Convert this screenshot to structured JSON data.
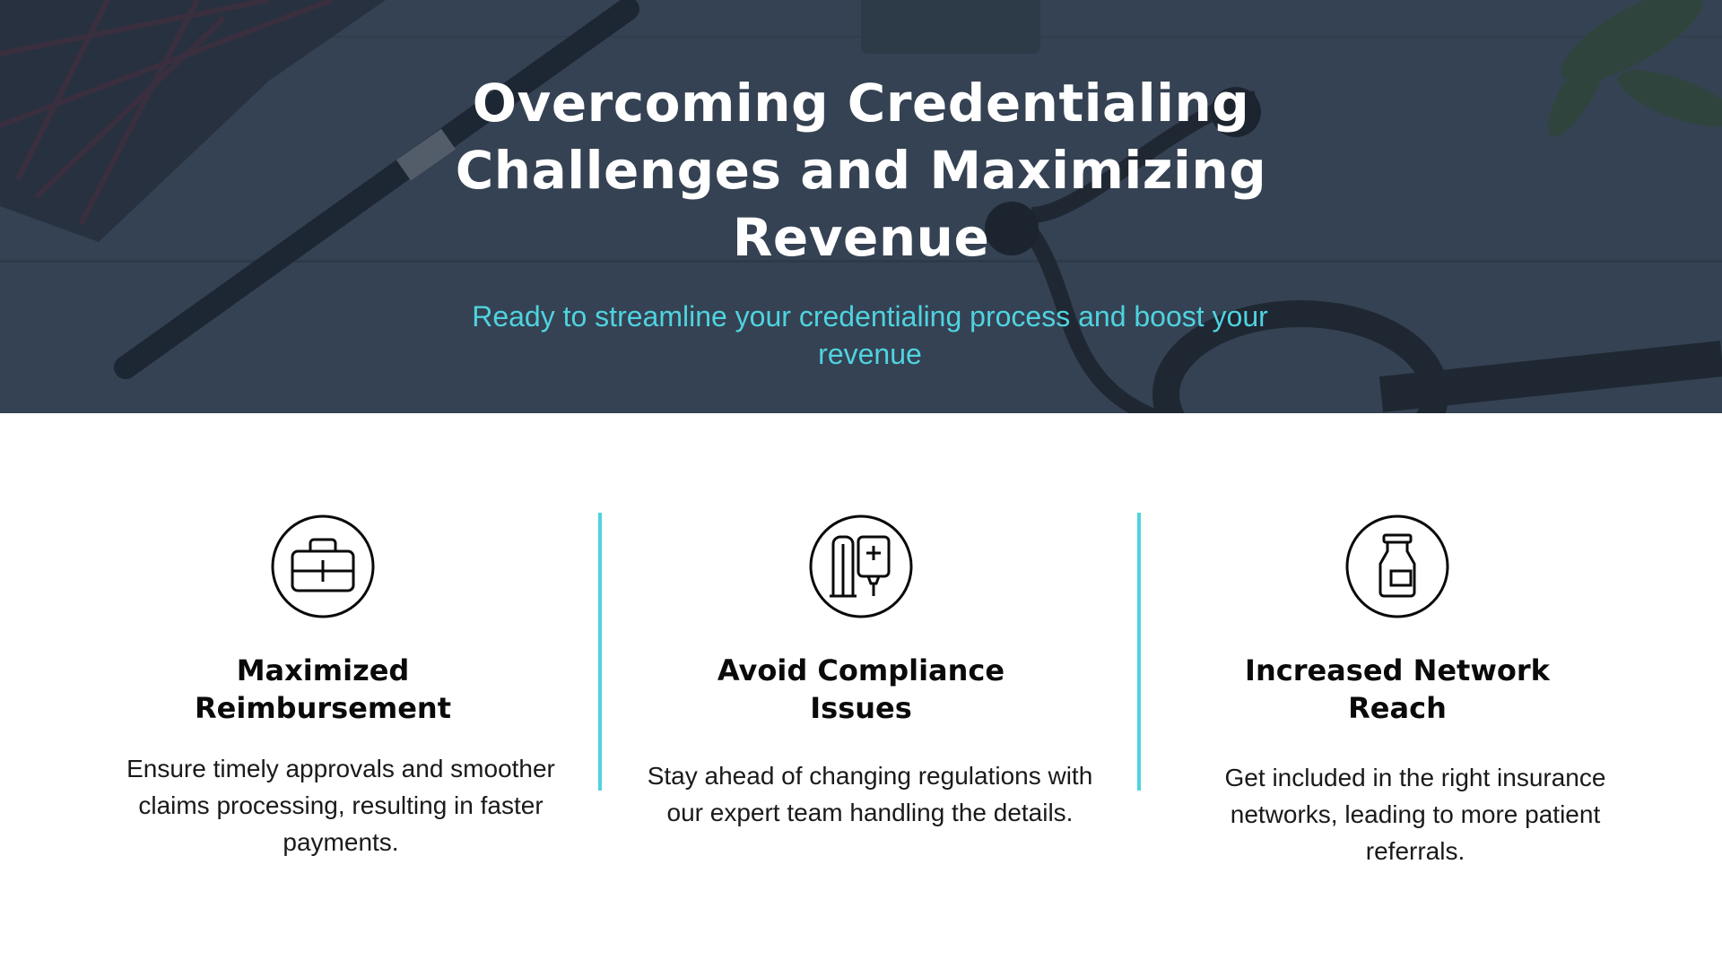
{
  "hero": {
    "title": "Overcoming Credentialing Challenges and Maximizing Revenue",
    "subtitle": "Ready to streamline your credentialing process and boost your revenue"
  },
  "features": [
    {
      "icon": "medical-kit-icon",
      "title": "Maximized Reimbursement",
      "text": "Ensure timely approvals and smoother claims processing, resulting in faster payments."
    },
    {
      "icon": "iv-drip-icon",
      "title": "Avoid Compliance Issues",
      "text": "Stay ahead of changing regulations with our expert team handling the details."
    },
    {
      "icon": "medicine-bottle-icon",
      "title": "Increased Network Reach",
      "text": "Get included in the right insurance networks, leading to more patient referrals."
    }
  ],
  "colors": {
    "accent": "#4fd3df",
    "hero_overlay": "#3c4a58",
    "text_dark": "#0a0a0a"
  }
}
